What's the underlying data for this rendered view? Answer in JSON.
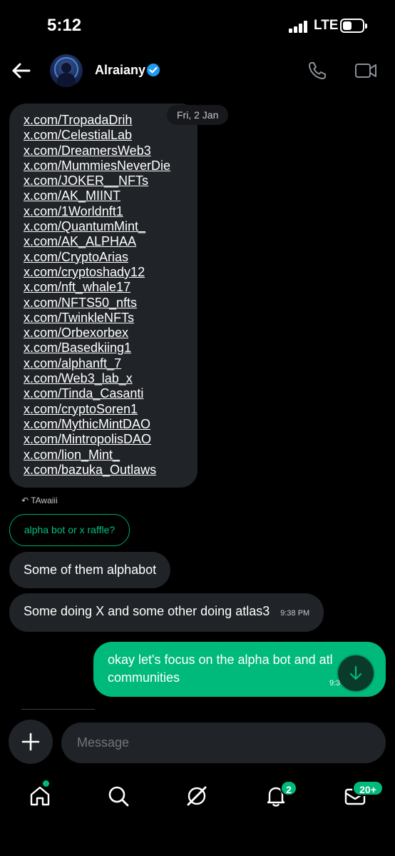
{
  "status": {
    "time": "5:12",
    "network": "LTE"
  },
  "header": {
    "contact_name": "Alraiany"
  },
  "date_chip": "Fri, 2 Jan",
  "links": [
    "x.com/TropadaDrih",
    "x.com/CelestialLab",
    "x.com/DreamersWeb3",
    "x.com/MummiesNeverDie",
    "x.com/JOKER__NFTs",
    "x.com/AK_MIINT",
    "x.com/1Worldnft1",
    "x.com/QuantumMint_",
    "x.com/AK_ALPHAA",
    "x.com/CryptoArias",
    "x.com/cryptoshady12",
    "x.com/nft_whale17",
    "x.com/NFTS50_nfts",
    "x.com/TwinkleNFTs",
    "x.com/Orbexorbex",
    "x.com/Basedkiing1",
    "x.com/alphanft_7",
    "x.com/Web3_lab_x",
    "x.com/Tinda_Casanti",
    "x.com/cryptoSoren1",
    "x.com/MythicMintDAO",
    "x.com/MintropolisDAO",
    "x.com/lion_Mint_",
    "x.com/bazuka_Outlaws"
  ],
  "reply": {
    "ref_label": "TAwaiii",
    "quoted_text": "alpha bot or x raffle?"
  },
  "messages": {
    "incoming_1": "Some of them alphabot",
    "incoming_2": "Some doing X and some other doing atlas3",
    "incoming_2_time": "9:38 PM",
    "outgoing_1_line1": "okay let's focus on the alpha bot and atl",
    "outgoing_1_line2": "communities",
    "outgoing_1_time": "9:3"
  },
  "composer": {
    "placeholder": "Message"
  },
  "nav": {
    "notifications_badge": "2",
    "messages_badge": "20+"
  },
  "colors": {
    "accent": "#00ba7c",
    "bubble_incoming": "#202327",
    "verified": "#1d9bf0",
    "background": "#000000"
  }
}
